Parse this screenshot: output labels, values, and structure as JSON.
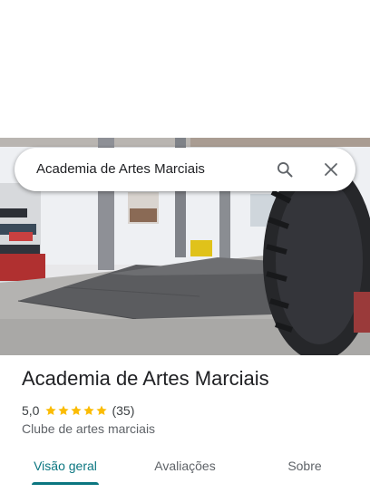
{
  "search": {
    "query": "Academia de Artes Marciais"
  },
  "place": {
    "title": "Academia de Artes Marciais",
    "rating": "5,0",
    "rating_value": 5.0,
    "stars_filled": 5,
    "review_count": "(35)",
    "category": "Clube de artes marciais"
  },
  "tabs": [
    {
      "label": "Visão geral",
      "active": true
    },
    {
      "label": "Avaliações",
      "active": false
    },
    {
      "label": "Sobre",
      "active": false
    }
  ],
  "colors": {
    "accent": "#0b7680",
    "star": "#fbbc04",
    "text_primary": "#202124",
    "text_secondary": "#5f6368"
  },
  "icons": {
    "search": "search-icon",
    "close": "close-icon",
    "star": "star-icon"
  }
}
